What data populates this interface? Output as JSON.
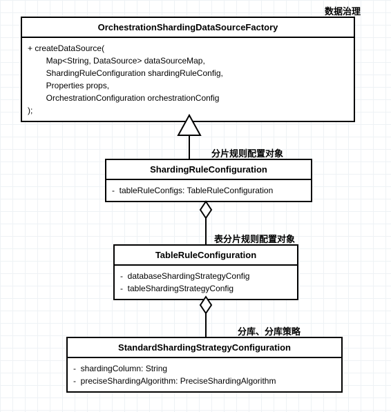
{
  "annotations": {
    "a1": "数据治理",
    "a2": "分片规则配置对象",
    "a3": "表分片规则配置对象",
    "a4": "分库、分库策略"
  },
  "class1": {
    "title": "OrchestrationShardingDataSourceFactory",
    "lines": {
      "l0": "+ createDataSource(",
      "l1": "        Map<String, DataSource> dataSourceMap,",
      "l2": "        ShardingRuleConfiguration shardingRuleConfig,",
      "l3": "        Properties props,",
      "l4": "        OrchestrationConfiguration orchestrationConfig",
      "l5": ");"
    }
  },
  "class2": {
    "title": "ShardingRuleConfiguration",
    "lines": {
      "l0": "-  tableRuleConfigs: TableRuleConfiguration"
    }
  },
  "class3": {
    "title": "TableRuleConfiguration",
    "lines": {
      "l0": "-  databaseShardingStrategyConfig",
      "l1": "-  tableShardingStrategyConfig"
    }
  },
  "class4": {
    "title": "StandardShardingStrategyConfiguration",
    "lines": {
      "l0": "-  shardingColumn: String",
      "l1": "-  preciseShardingAlgorithm: PreciseShardingAlgorithm"
    }
  },
  "chart_data": {
    "type": "table",
    "description": "UML class diagram with realization and aggregation relationships",
    "classes": [
      {
        "name": "OrchestrationShardingDataSourceFactory",
        "annotation": "数据治理",
        "methods": [
          "+ createDataSource(Map<String, DataSource> dataSourceMap, ShardingRuleConfiguration shardingRuleConfig, Properties props, OrchestrationConfiguration orchestrationConfig);"
        ]
      },
      {
        "name": "ShardingRuleConfiguration",
        "annotation": "分片规则配置对象",
        "attributes": [
          "- tableRuleConfigs: TableRuleConfiguration"
        ]
      },
      {
        "name": "TableRuleConfiguration",
        "annotation": "表分片规则配置对象",
        "attributes": [
          "- databaseShardingStrategyConfig",
          "- tableShardingStrategyConfig"
        ]
      },
      {
        "name": "StandardShardingStrategyConfiguration",
        "annotation": "分库、分库策略",
        "attributes": [
          "- shardingColumn: String",
          "- preciseShardingAlgorithm: PreciseShardingAlgorithm"
        ]
      }
    ],
    "relationships": [
      {
        "from": "ShardingRuleConfiguration",
        "to": "OrchestrationShardingDataSourceFactory",
        "type": "realization"
      },
      {
        "from": "TableRuleConfiguration",
        "to": "ShardingRuleConfiguration",
        "type": "aggregation"
      },
      {
        "from": "StandardShardingStrategyConfiguration",
        "to": "TableRuleConfiguration",
        "type": "aggregation"
      }
    ]
  }
}
